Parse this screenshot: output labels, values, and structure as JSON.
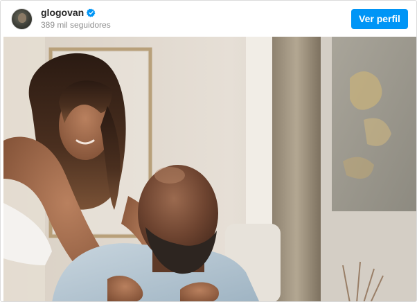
{
  "header": {
    "username": "glogovan",
    "followers": "389 mil seguidores",
    "profile_button": "Ver perfil"
  },
  "colors": {
    "accent": "#0095f6",
    "verified_badge": "#0095f6"
  },
  "icons": {
    "verified": "verified-badge-icon",
    "avatar": "profile-avatar"
  }
}
